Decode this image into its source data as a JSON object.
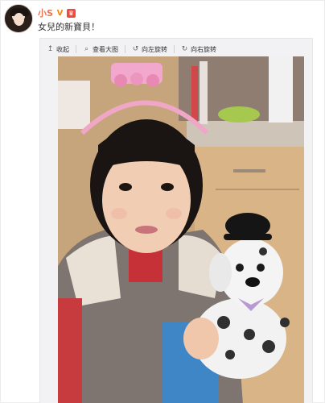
{
  "post": {
    "author": "小S",
    "text": "女兒的新寶貝！",
    "badges": {
      "verified_icon": "v-verified-icon",
      "member_icon": "member-crown-icon"
    }
  },
  "toolbar": {
    "collapse_label": "收起",
    "view_large_label": "查看大图",
    "rotate_left_label": "向左旋转",
    "rotate_right_label": "向右旋转"
  },
  "colors": {
    "author_name": "#eb7350",
    "verified_badge": "#ff8200",
    "member_badge": "#ef4a3e",
    "media_background": "#f2f2f5"
  }
}
